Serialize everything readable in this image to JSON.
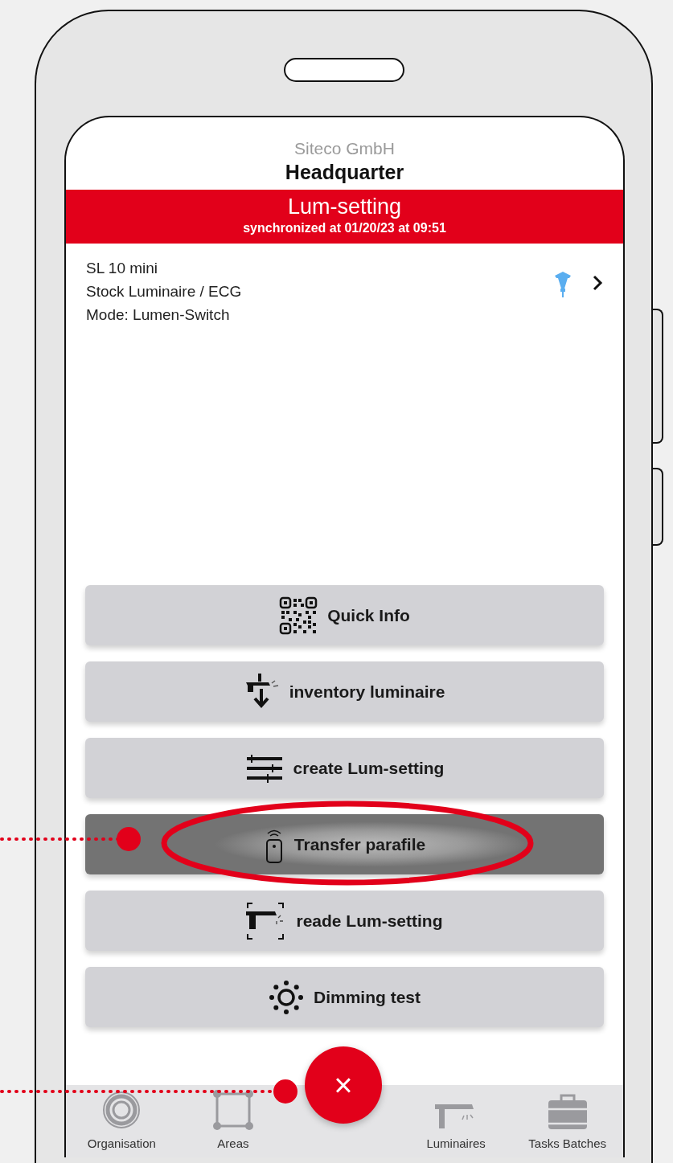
{
  "header": {
    "company": "Siteco GmbH",
    "site": "Headquarter"
  },
  "banner": {
    "title": "Lum-setting",
    "subtitle": "synchronized at 01/20/23 at 09:51"
  },
  "luminaire": {
    "lines": [
      "SL 10 mini",
      "Stock Luminaire / ECG",
      "Mode: Lumen-Switch"
    ]
  },
  "actions": [
    {
      "label": "Quick Info",
      "selected": false
    },
    {
      "label": "inventory luminaire",
      "selected": false
    },
    {
      "label": "create Lum-setting",
      "selected": false
    },
    {
      "label": "Transfer parafile",
      "selected": true
    },
    {
      "label": "reade Lum-setting",
      "selected": false
    },
    {
      "label": "Dimming test",
      "selected": false
    }
  ],
  "fab": {
    "symbol": "×"
  },
  "tabs": [
    {
      "label": "Organisation"
    },
    {
      "label": "Areas"
    },
    {
      "label": "Luminaires"
    },
    {
      "label": "Tasks Batches"
    }
  ]
}
